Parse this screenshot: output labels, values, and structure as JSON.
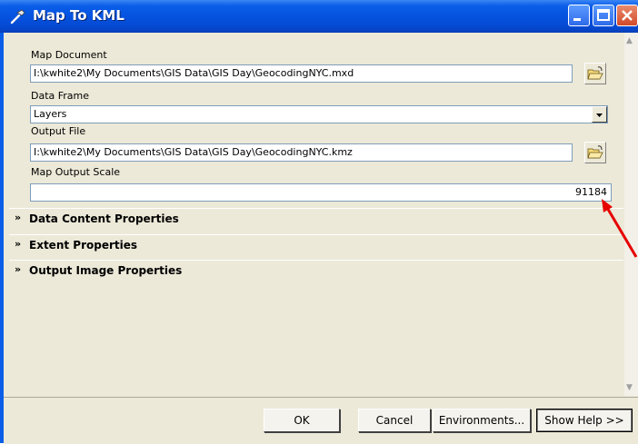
{
  "window": {
    "title": "Map To KML"
  },
  "form": {
    "map_document": {
      "label": "Map Document",
      "value": "I:\\kwhite2\\My Documents\\GIS Data\\GIS Day\\GeocodingNYC.mxd"
    },
    "data_frame": {
      "label": "Data Frame",
      "value": "Layers"
    },
    "output_file": {
      "label": "Output File",
      "value": "I:\\kwhite2\\My Documents\\GIS Data\\GIS Day\\GeocodingNYC.kmz"
    },
    "map_output_scale": {
      "label": "Map Output Scale",
      "value": "91184"
    }
  },
  "sections": [
    {
      "label": "Data Content Properties"
    },
    {
      "label": "Extent Properties"
    },
    {
      "label": "Output Image Properties"
    }
  ],
  "buttons": {
    "ok": "OK",
    "cancel": "Cancel",
    "environments": "Environments...",
    "show_help": "Show Help >>"
  },
  "icons": {
    "title": "hammer-icon",
    "browse": "folder-open-icon",
    "section_toggle": "double-chevron-down-icon"
  },
  "colors": {
    "titlebar": "#0553e0",
    "window_bg": "#ece9d8",
    "close_button": "#d24a2a",
    "annotation_arrow": "#e60000"
  }
}
